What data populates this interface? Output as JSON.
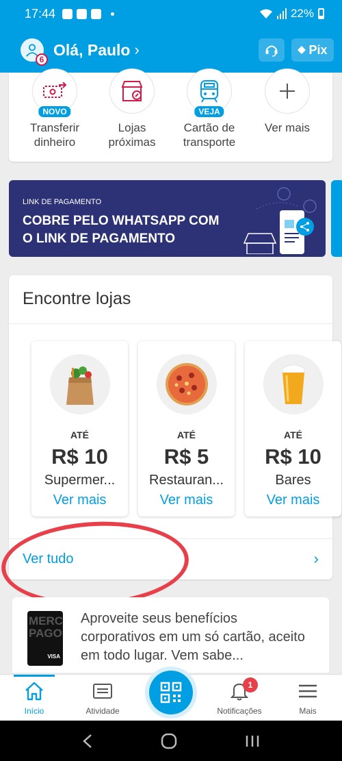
{
  "status_bar": {
    "time": "17:44",
    "battery": "22%"
  },
  "header": {
    "greeting": "Olá, Paulo",
    "notification_count": "6",
    "pix_label": "Pix"
  },
  "shortcuts": [
    {
      "label": "Transferir\ndinheiro",
      "tag": "NOVO",
      "icon": "transfer-icon"
    },
    {
      "label": "Lojas\npróximas",
      "tag": "",
      "icon": "store-icon"
    },
    {
      "label": "Cartão de\ntransporte",
      "tag": "VEJA",
      "icon": "bus-icon"
    },
    {
      "label": "Ver mais",
      "tag": "",
      "icon": "plus-icon"
    }
  ],
  "banner": {
    "kicker": "LINK DE PAGAMENTO",
    "title": "COBRE PELO WHATSAPP COM\nO LINK DE PAGAMENTO"
  },
  "stores": {
    "title": "Encontre lojas",
    "items": [
      {
        "kicker": "ATÉ",
        "amount": "R$ 10",
        "name": "Supermer...",
        "link": "Ver mais",
        "icon": "grocery-bag-icon"
      },
      {
        "kicker": "ATÉ",
        "amount": "R$ 5",
        "name": "Restauran...",
        "link": "Ver mais",
        "icon": "pizza-icon"
      },
      {
        "kicker": "ATÉ",
        "amount": "R$ 10",
        "name": "Bares",
        "link": "Ver mais",
        "icon": "beer-icon"
      }
    ],
    "see_all": "Ver tudo"
  },
  "promo": {
    "text": "Aproveite seus benefícios corporativos em um só cartão, aceito em todo lugar. Vem sabe...",
    "card_text": "MERCADO PAGO",
    "card_brand": "VISA"
  },
  "bottom_nav": {
    "home": "Início",
    "activity": "Atividade",
    "notifications": "Notificações",
    "notifications_badge": "1",
    "more": "Mais"
  },
  "colors": {
    "brand": "#009ee3",
    "banner": "#2d3277",
    "annotation": "#e8404b"
  }
}
